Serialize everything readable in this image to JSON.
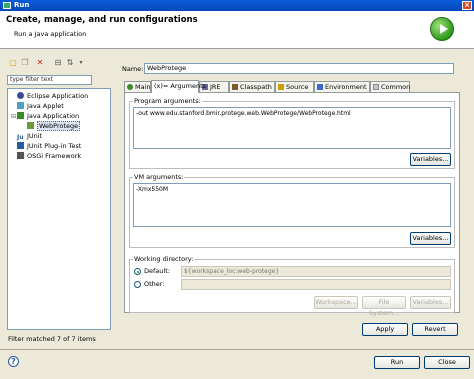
{
  "window": {
    "title": "Run"
  },
  "banner": {
    "heading": "Create, manage, and run configurations",
    "subtitle": "Run a Java application"
  },
  "toolbar": {
    "icons": [
      "new-config-icon",
      "duplicate-icon",
      "delete-icon",
      "collapse-all-icon",
      "filter-icon",
      "dropdown-arrow-icon"
    ]
  },
  "filter": {
    "placeholder": "type filter text"
  },
  "tree": {
    "items": [
      {
        "label": "Eclipse Application",
        "icon": "eclipse-app-icon",
        "color": "#3a4a9a"
      },
      {
        "label": "Java Applet",
        "icon": "java-applet-icon",
        "color": "#4aa0c8"
      },
      {
        "label": "Java Application",
        "icon": "java-application-icon",
        "color": "#3a8a2a"
      },
      {
        "label": "WebProtege",
        "icon": "java-config-icon",
        "color": "#6a9a3a"
      },
      {
        "label": "JUnit",
        "icon": "junit-icon",
        "color": "#2a5aa0"
      },
      {
        "label": "JUnit Plug-in Test",
        "icon": "junit-plugin-icon",
        "color": "#2a5aa0"
      },
      {
        "label": "OSGi Framework",
        "icon": "osgi-icon",
        "color": "#555555"
      }
    ]
  },
  "status": {
    "text": "Filter matched 7 of 7 items"
  },
  "config": {
    "name_label": "Name:",
    "name_value": "WebProtege"
  },
  "tabs": [
    "Main",
    "(x)= Arguments",
    "JRE",
    "Classpath",
    "Source",
    "Environment",
    "Common"
  ],
  "arguments": {
    "program_label": "Program arguments:",
    "program_value": "-out www.edu.stanford.bmir.protege.web.WebProtege/WebProtege.html",
    "variables_label": "Variables...",
    "vm_label": "VM arguments:",
    "vm_value": "-Xmx550M",
    "vm_variables_label": "Variables..."
  },
  "working_dir": {
    "label": "Working directory:",
    "default_label": "Default:",
    "default_value": "${workspace_loc:web-protege}",
    "other_label": "Other:",
    "workspace_btn": "Workspace...",
    "filesystem_btn": "File System...",
    "variables_btn": "Variables..."
  },
  "actions": {
    "apply": "Apply",
    "revert": "Revert",
    "run": "Run",
    "close": "Close"
  }
}
